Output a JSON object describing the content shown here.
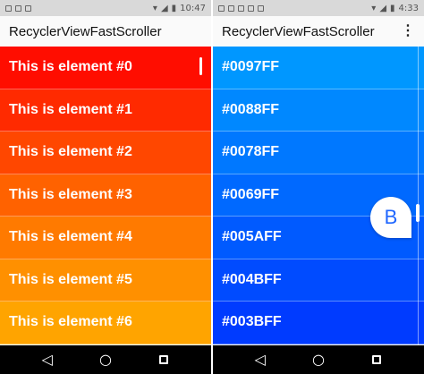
{
  "left": {
    "status": {
      "time": "10:47"
    },
    "app_title": "RecyclerViewFastScroller",
    "rows": [
      {
        "label": "This is element #0",
        "color": "#ff0d00"
      },
      {
        "label": "This is element #1",
        "color": "#ff2a00"
      },
      {
        "label": "This is element #2",
        "color": "#ff4700"
      },
      {
        "label": "This is element #3",
        "color": "#ff6200"
      },
      {
        "label": "This is element #4",
        "color": "#ff7a00"
      },
      {
        "label": "This is element #5",
        "color": "#ff9000"
      },
      {
        "label": "This is element #6",
        "color": "#ffa400"
      }
    ]
  },
  "right": {
    "status": {
      "time": "4:33"
    },
    "app_title": "RecyclerViewFastScroller",
    "menu_icon": "⋮",
    "bubble_letter": "B",
    "rows": [
      {
        "label": "#0097FF",
        "color": "#0097ff"
      },
      {
        "label": "#0088FF",
        "color": "#0088ff"
      },
      {
        "label": "#0078FF",
        "color": "#0078ff"
      },
      {
        "label": "#0069FF",
        "color": "#0069ff"
      },
      {
        "label": "#005AFF",
        "color": "#005aff"
      },
      {
        "label": "#004BFF",
        "color": "#004bff"
      },
      {
        "label": "#003BFF",
        "color": "#003bff"
      }
    ]
  },
  "nav": {
    "back": "◁",
    "home": "○"
  }
}
